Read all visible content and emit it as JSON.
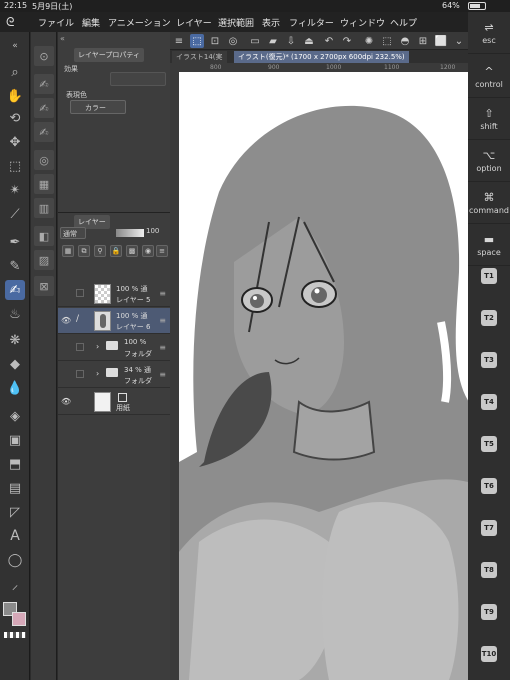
{
  "status": {
    "time": "22:15",
    "date": "5月9日(土)",
    "battery": "64%"
  },
  "menu": [
    "ファイル",
    "編集",
    "アニメーション",
    "レイヤー",
    "選択範囲",
    "表示",
    "フィルター",
    "ウィンドウ",
    "ヘルプ"
  ],
  "property_panel": {
    "tab": "レイヤープロパティ",
    "effect_label": "効果",
    "display_color_label": "表現色",
    "display_color_value": "カラー"
  },
  "layer_panel": {
    "tab": "レイヤー",
    "blend_mode": "通常",
    "opacity": "100",
    "layers": [
      {
        "pct": "100 % 通",
        "name": "レイヤー 5",
        "visible": false,
        "selected": false,
        "kind": "layer",
        "thumb": "trans"
      },
      {
        "pct": "100 % 通",
        "name": "レイヤー 6",
        "visible": true,
        "selected": true,
        "kind": "layer",
        "thumb": "figure"
      },
      {
        "pct": "100 %",
        "name": "フォルダ",
        "visible": false,
        "selected": false,
        "kind": "folder"
      },
      {
        "pct": "34 % 通",
        "name": "フォルダ",
        "visible": false,
        "selected": false,
        "kind": "folder"
      },
      {
        "pct": "",
        "name": "用紙",
        "visible": true,
        "selected": false,
        "kind": "paper"
      }
    ]
  },
  "doc_tabs": [
    "イラスト14(実",
    "イラスト(復元)* (1700 x 2700px 600dpi 232.5%)"
  ],
  "ruler_marks": [
    "800",
    "900",
    "1000",
    "1100",
    "1200"
  ],
  "commands": {
    "esc": "esc",
    "control": "control",
    "shift": "shift",
    "option": "option",
    "command": "command",
    "space": "space",
    "tkeys": [
      "T1",
      "T2",
      "T3",
      "T4",
      "T5",
      "T6",
      "T7",
      "T8",
      "T9",
      "T10"
    ]
  }
}
